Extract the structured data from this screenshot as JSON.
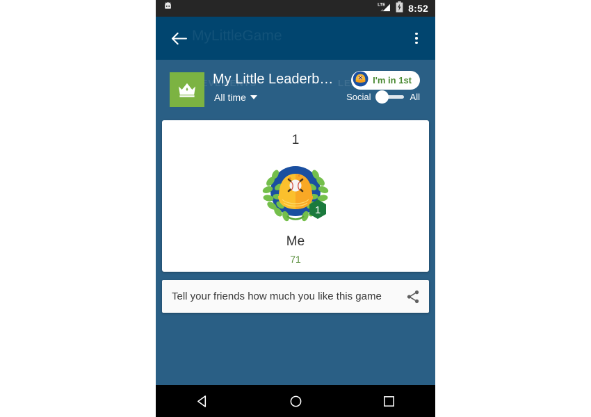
{
  "status_bar": {
    "notification_icon": "android-robot-icon",
    "network_label": "LTE",
    "signal_icon": "signal-bars-icon",
    "battery_icon": "battery-charging-icon",
    "time": "8:52"
  },
  "app_bar": {
    "back_icon": "back-arrow-icon",
    "title": "MyLittleGame",
    "overflow_icon": "overflow-menu-icon"
  },
  "leaderboard_header": {
    "ghost_tabs": [
      "ACHIEVEMENTS",
      "LEADERBOARD"
    ],
    "crown_icon": "crown-icon",
    "title": "My Little Leaderb…",
    "timespan": "All time",
    "timespan_caret_icon": "chevron-down-icon",
    "rank_chip": {
      "avatar_icon": "player-avatar-icon",
      "label": "I'm in 1st"
    },
    "toggle": {
      "left_label": "Social",
      "right_label": "All",
      "selected": "Social"
    }
  },
  "player_card": {
    "rank": "1",
    "avatar_icon": "baseball-cap-laurel-avatar-icon",
    "badge_rank": "1",
    "name": "Me",
    "score": "71"
  },
  "share_card": {
    "text": "Tell your friends how much you like this game",
    "share_icon": "share-icon"
  },
  "nav_bar": {
    "back_icon": "nav-back-icon",
    "home_icon": "nav-home-icon",
    "recents_icon": "nav-recents-icon"
  },
  "colors": {
    "background": "#2a5f85",
    "app_bar": "#01456f",
    "status_bar": "#262626",
    "accent_green": "#7cb342",
    "score_green": "#5a8f3d",
    "badge_green": "#1b7a3d",
    "card": "#ffffff"
  }
}
